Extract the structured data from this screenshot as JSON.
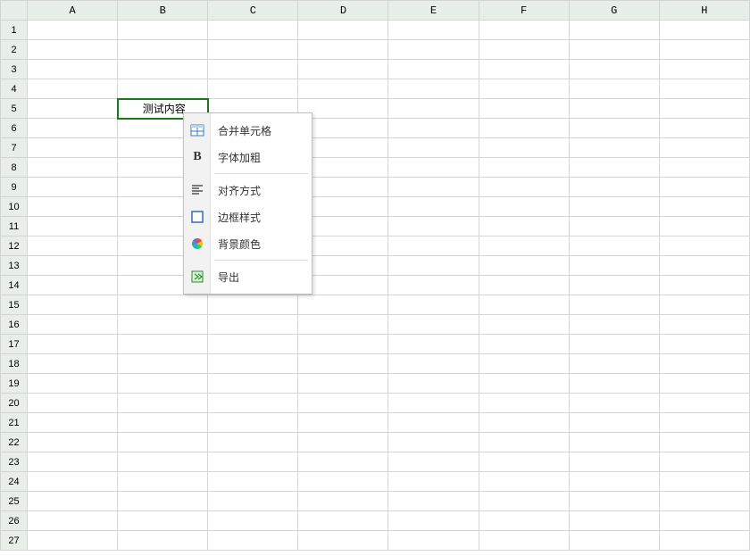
{
  "columns": [
    "A",
    "B",
    "C",
    "D",
    "E",
    "F",
    "G",
    "H"
  ],
  "rowCount": 27,
  "selected": {
    "row": 5,
    "col": "B",
    "value": "测试内容"
  },
  "contextMenu": {
    "groups": [
      [
        {
          "id": "merge",
          "icon": "merge-cells-icon",
          "label": "合并单元格"
        },
        {
          "id": "bold",
          "icon": "bold-icon",
          "label": "字体加粗"
        }
      ],
      [
        {
          "id": "align",
          "icon": "align-icon",
          "label": "对齐方式"
        },
        {
          "id": "border",
          "icon": "border-style-icon",
          "label": "边框样式"
        },
        {
          "id": "bgcolor",
          "icon": "bgcolor-icon",
          "label": "背景颜色"
        }
      ],
      [
        {
          "id": "export",
          "icon": "export-icon",
          "label": "导出"
        }
      ]
    ]
  }
}
